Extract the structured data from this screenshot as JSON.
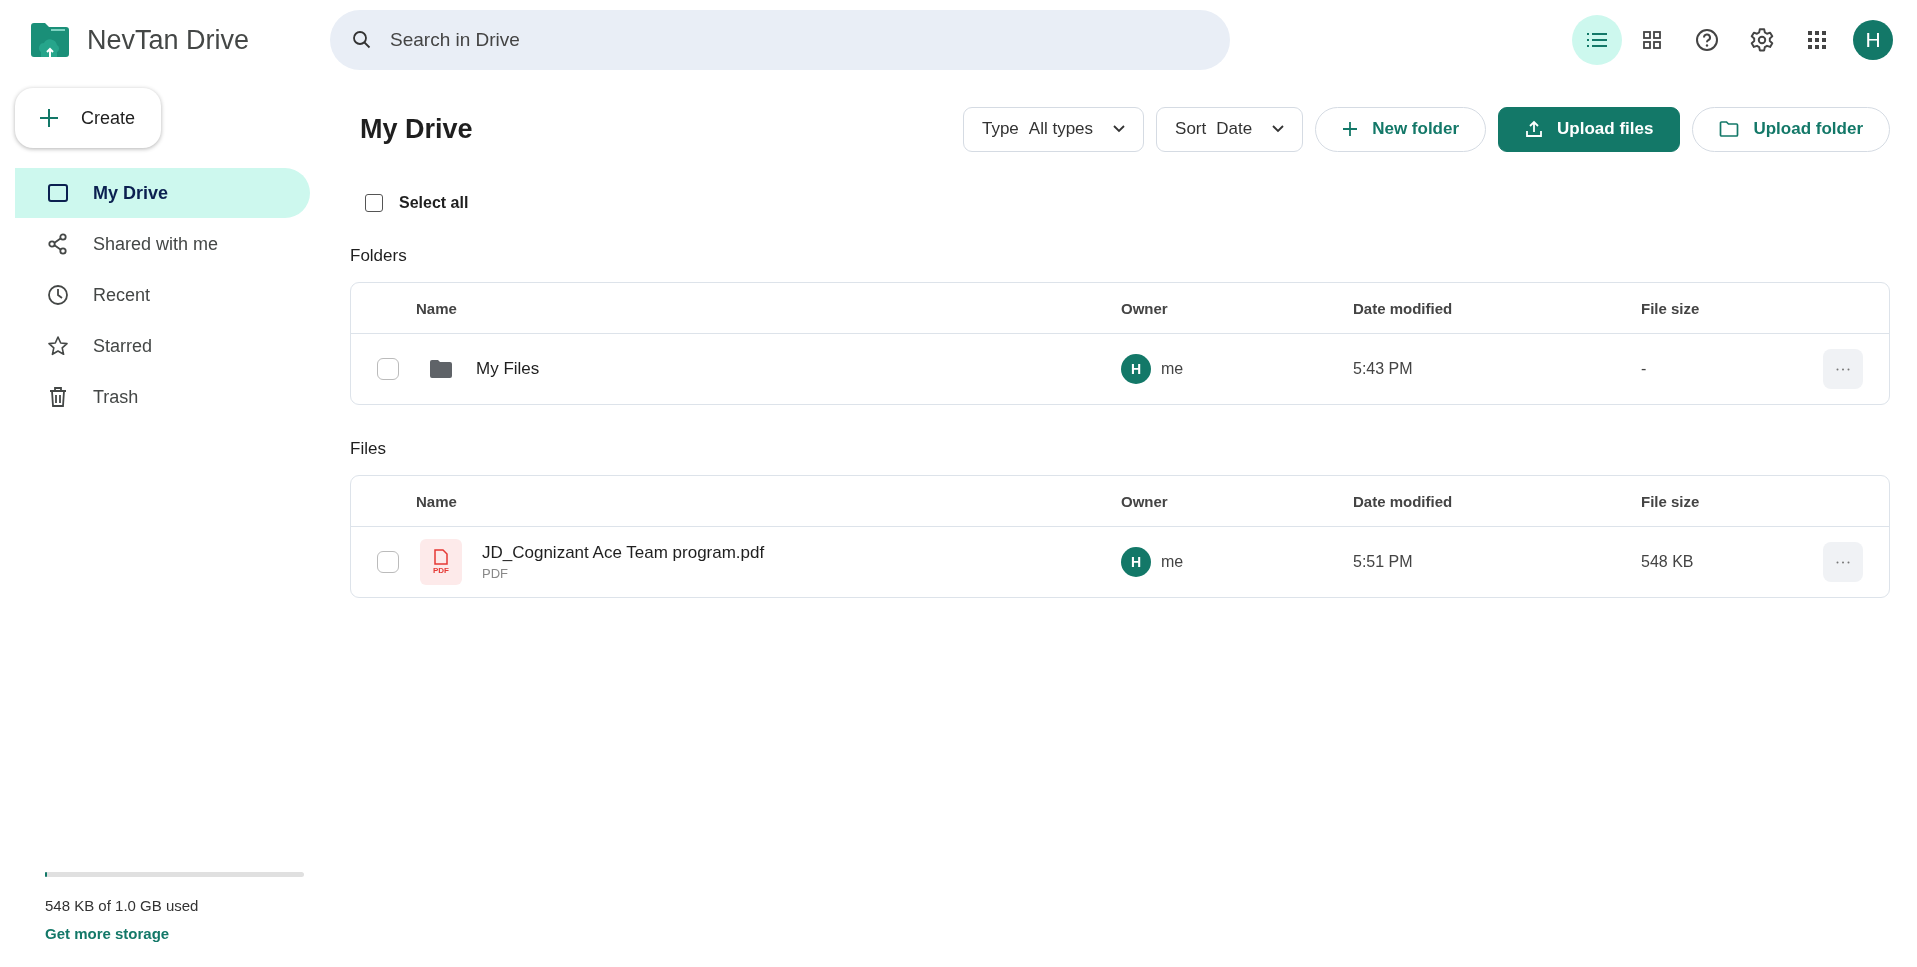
{
  "app": {
    "name": "NevTan Drive"
  },
  "search": {
    "placeholder": "Search in Drive"
  },
  "view_toggle": [
    {
      "kind": "list",
      "selected": true
    },
    {
      "kind": "grid",
      "selected": false
    }
  ],
  "avatar": {
    "initial": "H"
  },
  "create_button": {
    "label": "Create"
  },
  "nav": [
    {
      "kind": "drive",
      "label": "My Drive",
      "selected": true
    },
    {
      "kind": "shared",
      "label": "Shared with me",
      "selected": false
    },
    {
      "kind": "recent",
      "label": "Recent",
      "selected": false
    },
    {
      "kind": "starred",
      "label": "Starred",
      "selected": false
    },
    {
      "kind": "trash",
      "label": "Trash",
      "selected": false
    }
  ],
  "page_title": "My Drive",
  "filters": [
    {
      "label": "Type",
      "value": "All types"
    },
    {
      "label": "Sort",
      "value": "Date"
    }
  ],
  "actions": [
    {
      "kind": "new_folder",
      "label": "New folder",
      "primary": false
    },
    {
      "kind": "upload_files",
      "label": "Upload files",
      "primary": true
    },
    {
      "kind": "upload_folder",
      "label": "Upload folder",
      "primary": false
    }
  ],
  "select_all": {
    "label": "Select all",
    "checked": false
  },
  "sections": [
    {
      "title": "Folders",
      "columns": [
        "Name",
        "Owner",
        "Date modified",
        "File size"
      ],
      "rows": [
        {
          "kind": "folder",
          "name": "My Files",
          "owner_initial": "H",
          "owner": "me",
          "modified": "5:43 PM",
          "size": "-",
          "checked": false
        }
      ]
    },
    {
      "title": "Files",
      "columns": [
        "Name",
        "Owner",
        "Date modified",
        "File size"
      ],
      "rows": [
        {
          "kind": "pdf",
          "name": "JD_Cognizant Ace Team program.pdf",
          "type": "PDF",
          "icon_label": "PDF",
          "owner_initial": "H",
          "owner": "me",
          "modified": "5:51 PM",
          "size": "548 KB",
          "checked": false
        }
      ]
    }
  ],
  "storage": {
    "level": 0.005,
    "text": "548 KB of 1.0 GB used",
    "link": "Get more storage"
  }
}
